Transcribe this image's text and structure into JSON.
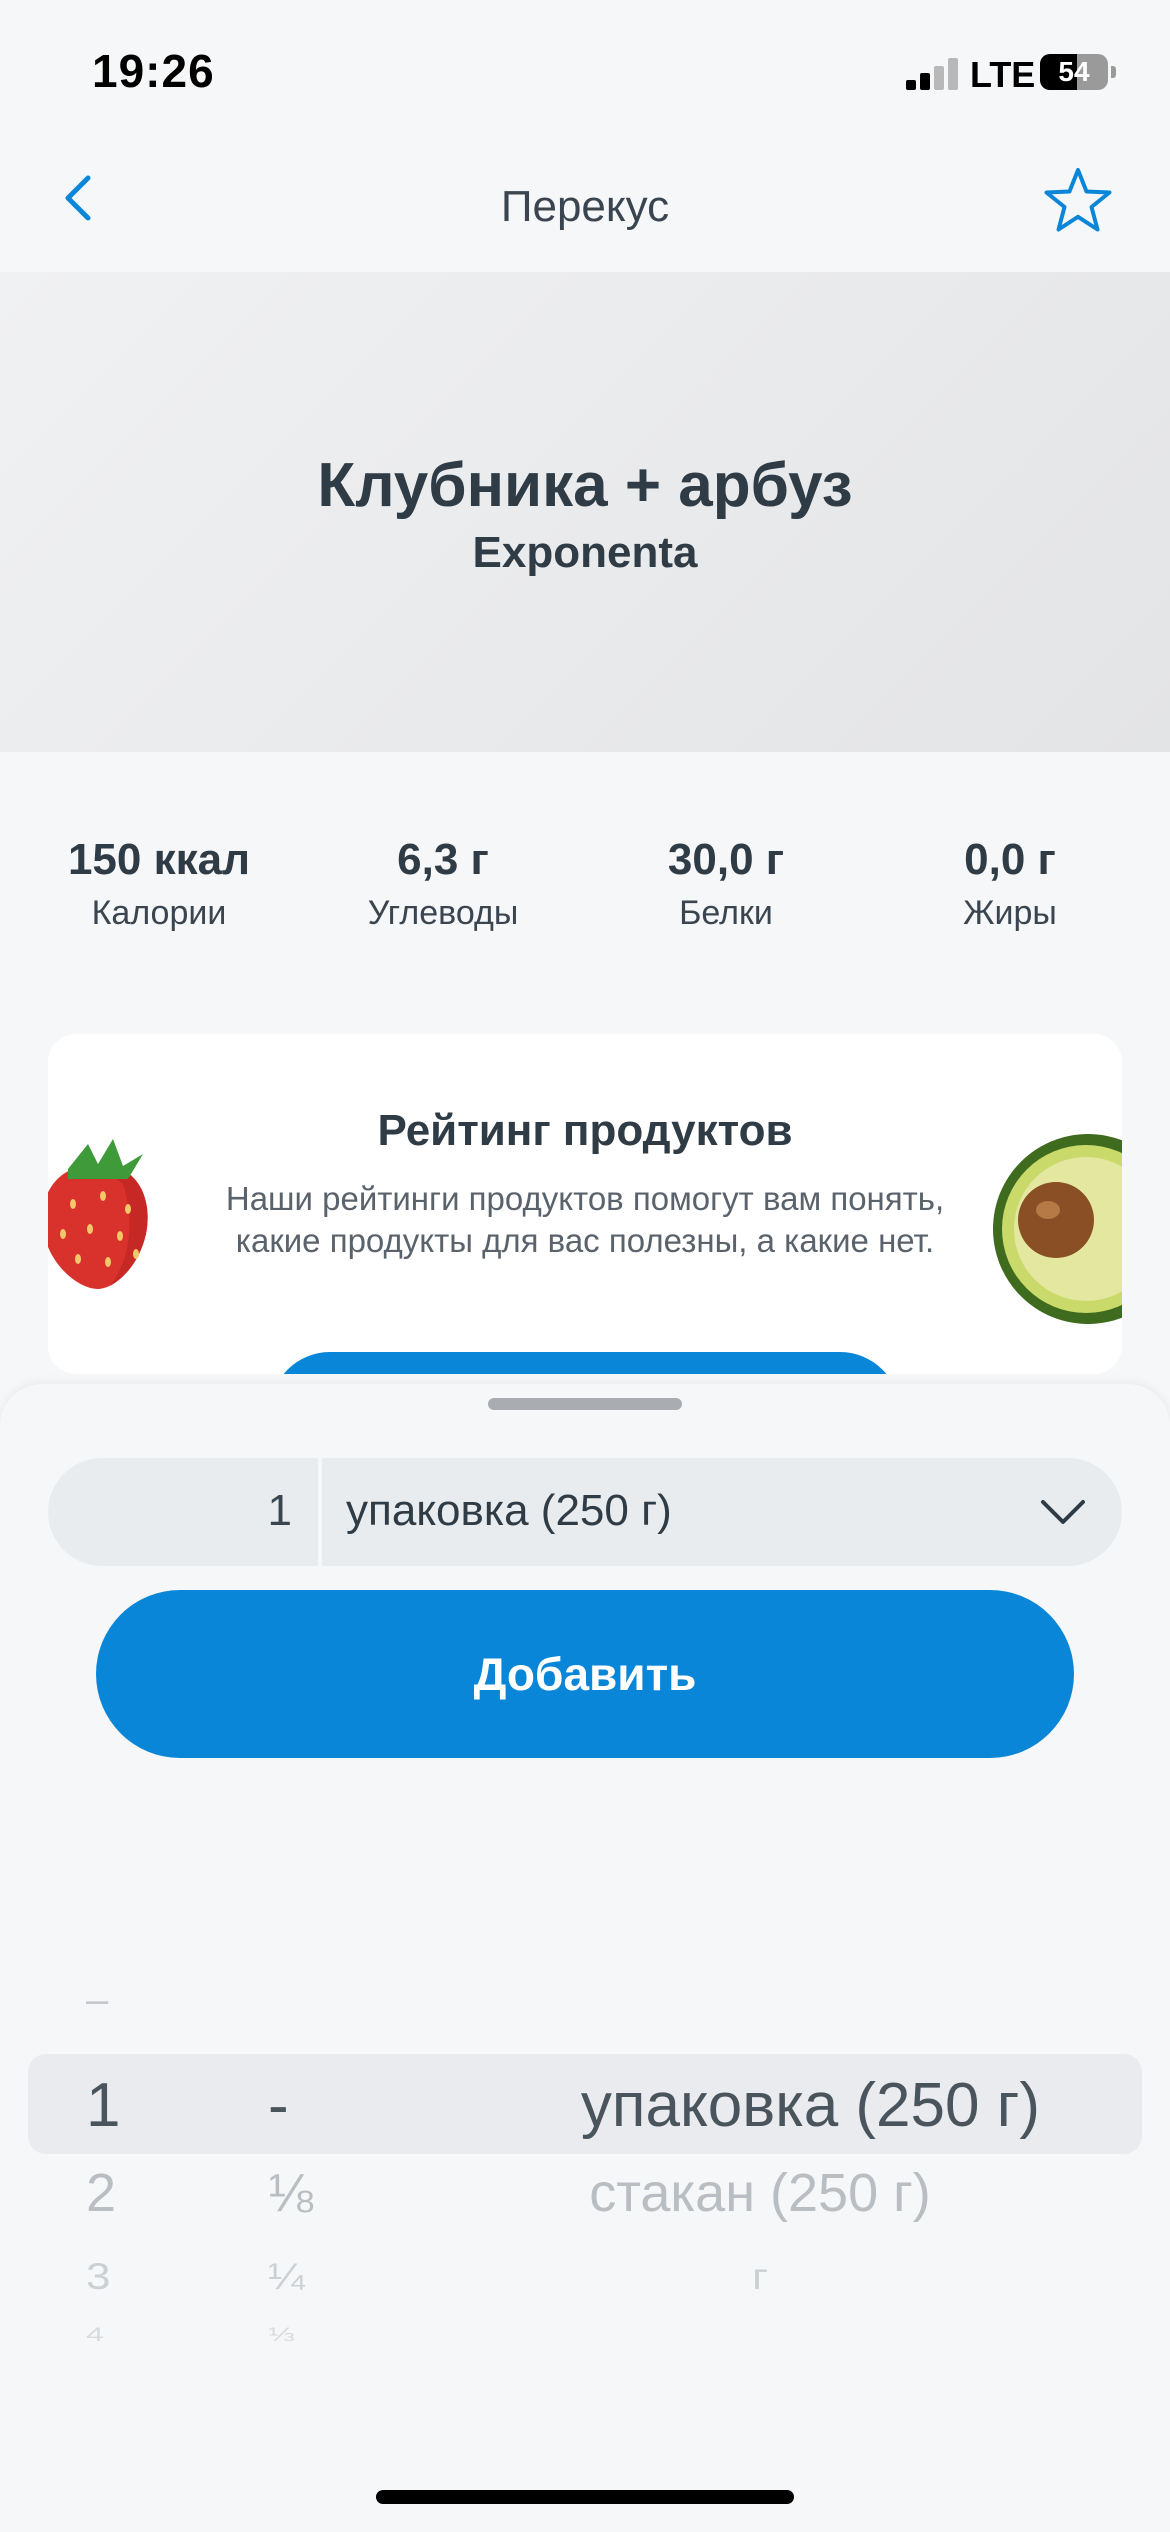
{
  "status_bar": {
    "time": "19:26",
    "network": "LTE",
    "battery_percent": "54",
    "battery_level": 0.54
  },
  "nav": {
    "title": "Перекус",
    "back_icon": "chevron-left-icon",
    "favorite_icon": "star-outline-icon"
  },
  "product": {
    "name": "Клубника + арбуз",
    "brand": "Exponenta"
  },
  "nutrients": [
    {
      "value": "150 ккал",
      "label": "Калории"
    },
    {
      "value": "6,3 г",
      "label": "Углеводы"
    },
    {
      "value": "30,0 г",
      "label": "Белки"
    },
    {
      "value": "0,0 г",
      "label": "Жиры"
    }
  ],
  "rating_card": {
    "title": "Рейтинг продуктов",
    "text": "Наши рейтинги продуктов помогут вам понять, какие продукты для вас полезны, а какие нет."
  },
  "serving": {
    "quantity": "1",
    "unit": "упаковка (250 г)",
    "add_label": "Добавить"
  },
  "picker": {
    "above": {
      "num": "–"
    },
    "selected": {
      "num": "1",
      "frac": "-",
      "unit": "упаковка (250 г)"
    },
    "rows": [
      {
        "num": "2",
        "frac": "⅛",
        "unit": "стакан (250 г)"
      },
      {
        "num": "3",
        "frac": "¼",
        "unit": "г"
      },
      {
        "num": "4",
        "frac": "⅓",
        "unit": ""
      }
    ]
  },
  "colors": {
    "accent": "#0A86D8",
    "text_dark": "#2F3B45",
    "background": "#F6F7F9"
  }
}
